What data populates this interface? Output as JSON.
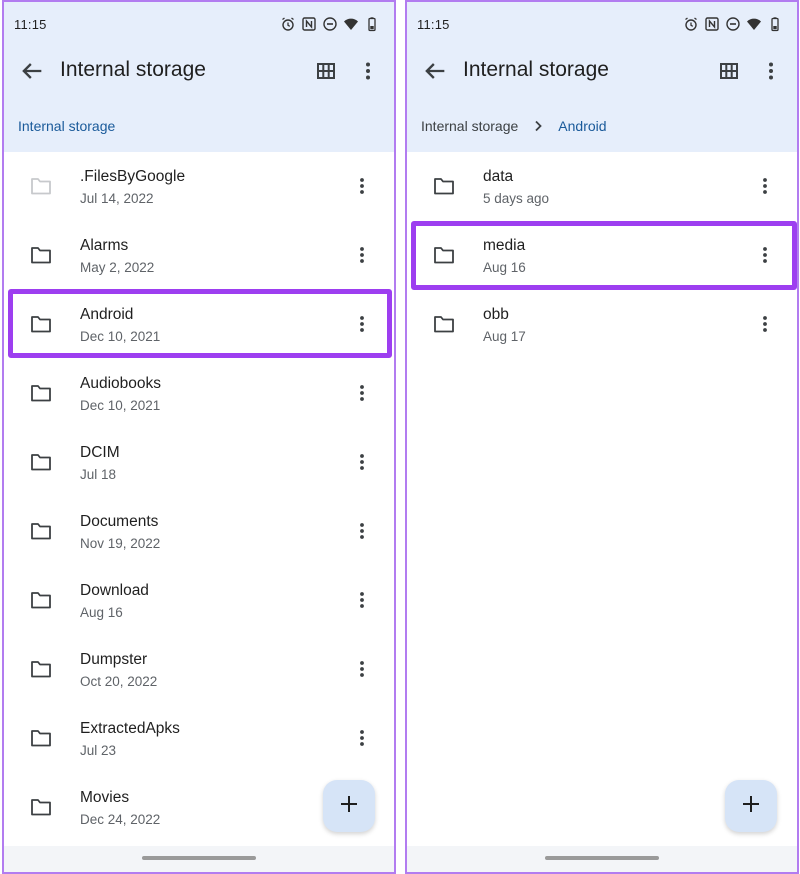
{
  "left": {
    "status_time": "11:15",
    "title": "Internal storage",
    "breadcrumbs": [
      "Internal storage"
    ],
    "items": [
      {
        "name": ".FilesByGoogle",
        "date": "Jul 14, 2022"
      },
      {
        "name": "Alarms",
        "date": "May 2, 2022"
      },
      {
        "name": "Android",
        "date": "Dec 10, 2021"
      },
      {
        "name": "Audiobooks",
        "date": "Dec 10, 2021"
      },
      {
        "name": "DCIM",
        "date": "Jul 18"
      },
      {
        "name": "Documents",
        "date": "Nov 19, 2022"
      },
      {
        "name": "Download",
        "date": "Aug 16"
      },
      {
        "name": "Dumpster",
        "date": "Oct 20, 2022"
      },
      {
        "name": "ExtractedApks",
        "date": "Jul 23"
      },
      {
        "name": "Movies",
        "date": "Dec 24, 2022"
      }
    ]
  },
  "right": {
    "status_time": "11:15",
    "title": "Internal storage",
    "breadcrumbs": [
      "Internal storage",
      "Android"
    ],
    "items": [
      {
        "name": "data",
        "date": "5 days ago"
      },
      {
        "name": "media",
        "date": "Aug 16"
      },
      {
        "name": "obb",
        "date": "Aug 17"
      }
    ]
  },
  "icons": {
    "status": [
      "alarm-icon",
      "nfc-icon",
      "do-not-disturb-icon",
      "wifi-icon",
      "battery-icon"
    ],
    "toolbar": [
      "back-arrow-icon",
      "grid-view-icon",
      "more-vert-icon"
    ],
    "fab": "plus-icon"
  },
  "colors": {
    "header_bg": "#e6eefb",
    "highlight": "#9d3ef0",
    "panel_border": "#b27cf0",
    "breadcrumb_active": "#1a5a9a",
    "fab_bg": "#d6e4f7"
  }
}
